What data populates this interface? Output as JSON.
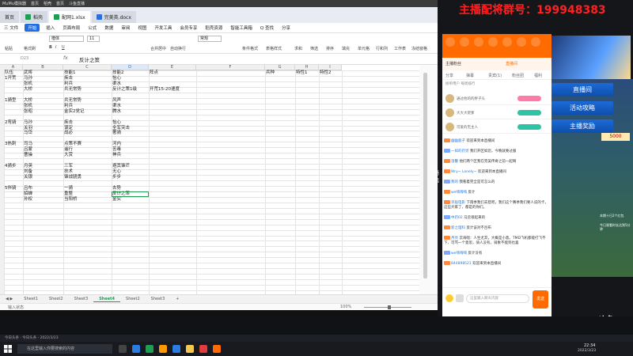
{
  "window": {
    "app_title": "MuMu模拟器",
    "tabs_top": [
      "首页",
      "稻壳",
      "首页",
      "斗鱼直播"
    ]
  },
  "file_tabs": [
    {
      "label": "首页"
    },
    {
      "label": "稻壳"
    },
    {
      "label": "配网1.xlsx",
      "active": true
    },
    {
      "label": "完美英.docx"
    }
  ],
  "menu": {
    "items": [
      "三 文件",
      "开始",
      "插入",
      "页面布局",
      "公式",
      "数据",
      "审阅",
      "视图",
      "开发工具",
      "会员专享",
      "稻壳资源",
      "智能工具箱"
    ],
    "search_label": "Q 查找",
    "share_label": "分享"
  },
  "ribbon": {
    "font_name": "楷体",
    "font_size": "11",
    "labels": [
      "粘贴",
      "格式刷",
      "合并居中",
      "自动换行",
      "常规",
      "条件格式",
      "表格样式",
      "求和",
      "筛选",
      "排序",
      "填充",
      "单元格",
      "行和列",
      "工作表",
      "冻结窗格"
    ]
  },
  "formula_bar": {
    "name_box": "D23",
    "fx": "fx",
    "value": "反计之策"
  },
  "grid": {
    "columns": [
      "A",
      "B",
      "C",
      "D",
      "E",
      "F",
      "G",
      "H",
      "I"
    ],
    "selected_column": "D",
    "header_row": [
      "队伍",
      "武将",
      "技能1",
      "技能2",
      "阵点",
      "",
      "兵种",
      "特性1",
      "特性2"
    ],
    "rows": [
      [
        "1开荒",
        "马孙",
        "疾击",
        "怡心"
      ],
      [
        "",
        "张机",
        "利兵",
        "渠水"
      ],
      [
        "",
        "大桥",
        "兵无常势",
        "反计之策1级",
        "开荒15-20速度"
      ],
      [],
      [
        "1骑型",
        "大桥",
        "兵无常势",
        "风声"
      ],
      [
        "",
        "张机",
        "利兵",
        "渠水"
      ],
      [
        "",
        "张昭",
        "金实2党记",
        "腾水"
      ],
      [],
      [
        "2弯骑",
        "马孙",
        "疾击",
        "怡心"
      ],
      [
        "",
        "关羽",
        "谋定",
        "全军突击"
      ],
      [
        "",
        "马岱",
        "战必",
        "奢骑"
      ],
      [],
      [
        "3热刺",
        "司马",
        "点策不赛",
        "河内"
      ],
      [
        "",
        "吕蒙",
        "遥行",
        "苦毒"
      ],
      [
        "",
        "曹操",
        "大赏",
        "神兵"
      ],
      [],
      [
        "4骑步",
        "月英",
        "三军",
        "避其锋芒"
      ],
      [
        "",
        "刘备",
        "扶术",
        "无心"
      ],
      [
        "",
        "关银",
        "锋战骁勇",
        "步步"
      ],
      [],
      [
        "5伴骑",
        "吕布",
        "一骑",
        "去势"
      ],
      [
        "",
        "貂蝉",
        "重整",
        "反计之策"
      ],
      [
        "",
        "孙权",
        "当阳桥",
        "金实"
      ]
    ]
  },
  "sheet_tabs": [
    "Sheet1",
    "Sheet2",
    "Sheet3",
    "Sheet4",
    "Sheet2",
    "Sheet3"
  ],
  "active_sheet": "Sheet4",
  "status": {
    "left": "输入状态",
    "zoom": "100%"
  },
  "stream": {
    "overlay_text": "主播配将群号：199948383",
    "anchor_title": "主播粉丝",
    "follow_label": "直播间",
    "subtabs": [
      "分享",
      "弹幕",
      "贵宾(1)",
      "粉丝团",
      "福利"
    ],
    "rank_tab_labels": [
      "榜单用户",
      "每周排行",
      "粉丝"
    ],
    "rank_rows": [
      {
        "name": "通过他的的胖子头"
      },
      {
        "name": "大大大佬爹"
      },
      {
        "name": "可爱的无主人"
      }
    ],
    "messages": [
      {
        "name": "幽幽鹿子",
        "text": "欢迎来到本直播间"
      },
      {
        "name": "一如的药觉",
        "text": "我们开区如您，今晚就要过服"
      },
      {
        "name": "温馨",
        "text": "他们两个区我在完美传奇之前一起啊"
      },
      {
        "name": "Wry~ Lonely~",
        "text": "欢迎来到本直播间"
      },
      {
        "name": "我的",
        "text": "我看着完全是可怎么的"
      },
      {
        "name": "we嗨嗨嗨",
        "text": "反计"
      },
      {
        "name": "邻居电影",
        "text": "下雨季我们去登吧，我们这个赛季我们要人说的卡，这些大家了，都是的你们。"
      },
      {
        "name": "中药02",
        "text": "马云很起来的"
      },
      {
        "name": "新之理科",
        "text": "反计该对不吕布"
      },
      {
        "name": "月亮",
        "text": "云海唱：人生尤其，大概是小意。TMD飞机都能打飞不下，可骂一个意思，骑人没有，骑象不能到也喜"
      },
      {
        "name": "we嗨嗨嗨",
        "text": "反计没有"
      },
      {
        "name": "844898521",
        "text": "欢迎来到本直播间"
      }
    ],
    "chat_placeholder": "这里输入聊天内容",
    "send_label": "发送",
    "side_buttons": [
      "直播间",
      "活动攻略",
      "主播奖励"
    ],
    "filter_label": "筛选",
    "ad_badge": "5000",
    "ad_small_lines": [
      "本期十日2个红包",
      "今日观看时长达到5分钟"
    ],
    "douyu_logo": "斗鱼"
  },
  "taskbar": {
    "search_text": "在这里输入你要搜索的内容",
    "time": "22:34",
    "date": "2022/3/23",
    "left_status": "今日头条 · 今日头条 · 2022/3/23"
  },
  "colors": {
    "wps_green": "#1f9d55",
    "douyu_orange": "#ff6b00",
    "overlay_red": "#ff2020",
    "button_blue": "#1c6ad8"
  }
}
